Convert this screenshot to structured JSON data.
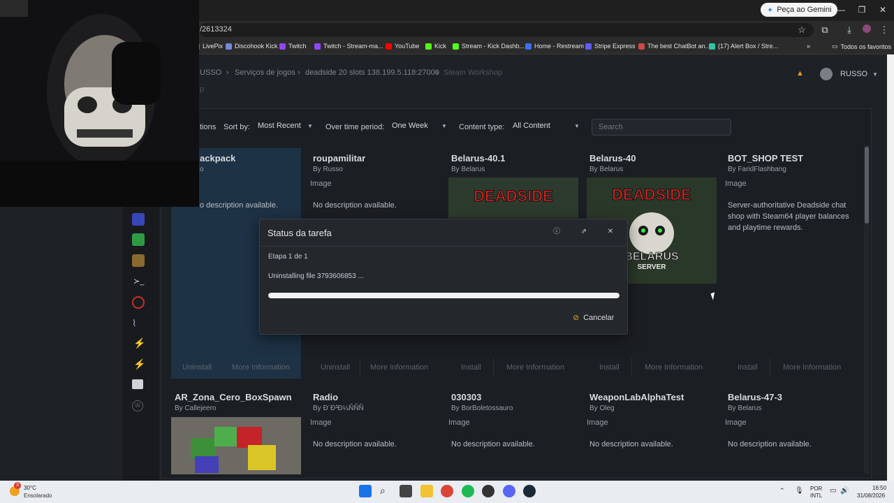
{
  "browser": {
    "gemini_button": "Peça ao Gemini",
    "url": "/2613324",
    "bookmarks": [
      {
        "label": "LivePix",
        "color": "#2a7de1"
      },
      {
        "label": "Discohook Kick",
        "color": "#7289da"
      },
      {
        "label": "Twitch",
        "color": "#9146ff"
      },
      {
        "label": "Twitch - Stream-ma...",
        "color": "#9146ff"
      },
      {
        "label": "YouTube",
        "color": "#ff0000"
      },
      {
        "label": "Kick",
        "color": "#53fc18"
      },
      {
        "label": "Stream - Kick Dashb...",
        "color": "#53fc18"
      },
      {
        "label": "Home - Restream",
        "color": "#3c6ff5"
      },
      {
        "label": "Stripe Express",
        "color": "#635bff"
      },
      {
        "label": "The best ChatBot an...",
        "color": "#d04848"
      },
      {
        "label": "(17) Alert Box / Stre...",
        "color": "#31c3a2"
      }
    ],
    "all_bookmarks": "Todos os favoritos"
  },
  "header": {
    "breadcrumbs": [
      "USSO",
      "Serviços de jogos",
      "deadside 20 slots 138.199.5.118:27000",
      "Steam Workshop"
    ],
    "sub_crumb": "p",
    "user": "RUSSO"
  },
  "filters": {
    "options_label": "tions",
    "sort_label": "Sort by:",
    "sort_value": "Most Recent",
    "period_label": "Over time period:",
    "period_value": "One Week",
    "content_label": "Content type:",
    "content_value": "All Content",
    "search_placeholder": "Search"
  },
  "cards_row1": [
    {
      "title": "ackpack",
      "by": "o",
      "desc": "o description available.",
      "btn1": "Uninstall",
      "btn2": "More Information"
    },
    {
      "title": "roupamilitar",
      "by": "By Russo",
      "img": "Image",
      "desc": "No description available.",
      "btn1": "Uninstall",
      "btn2": "More Information"
    },
    {
      "title": "Belarus-40.1",
      "by": "By Belarus",
      "btn1": "Install",
      "btn2": "More Information"
    },
    {
      "title": "Belarus-40",
      "by": "By Belarus",
      "btn1": "Install",
      "btn2": "More Information"
    },
    {
      "title": "BOT_SHOP TEST",
      "by": "By FaridFlashbang",
      "img": "Image",
      "desc": "Server-authoritative Deadside chat shop with Steam64 player balances and playtime rewards.",
      "btn1": "Install",
      "btn2": "More Information"
    }
  ],
  "cards_row2": [
    {
      "title": "AR_Zona_Cero_BoxSpawn",
      "by": "By Callejeero"
    },
    {
      "title": "Radio",
      "by": "By Ð¨Ð³Ð¼ÑÑÑ",
      "img": "Image",
      "desc": "No description available."
    },
    {
      "title": "030303",
      "by": "By BorBoletossauro",
      "img": "Image",
      "desc": "No description available."
    },
    {
      "title": "WeaponLabAlphaTest",
      "by": "By Oleg",
      "img": "Image",
      "desc": "No description available."
    },
    {
      "title": "Belarus-47-3",
      "by": "By Belarus",
      "img": "Image",
      "desc": "No description available."
    }
  ],
  "deadside_image": {
    "top_text": "DEADSIDE",
    "bottom_text1": "BELARUS",
    "bottom_text2": "SERVER"
  },
  "modal": {
    "title": "Status da tarefa",
    "stage": "Etapa 1 de 1",
    "message": "Uninstalling file 3793606853 ...",
    "progress": 1.0,
    "cancel": "Cancelar"
  },
  "taskbar": {
    "temp": "30°C",
    "weather": "Ensolarado",
    "weather_badge": "3",
    "lang1": "POR",
    "lang2": "INTL",
    "time": "16:50",
    "date": "31/08/2026"
  },
  "colors": {
    "accent": "#e3a21a",
    "progress": "#f2f2f2"
  }
}
